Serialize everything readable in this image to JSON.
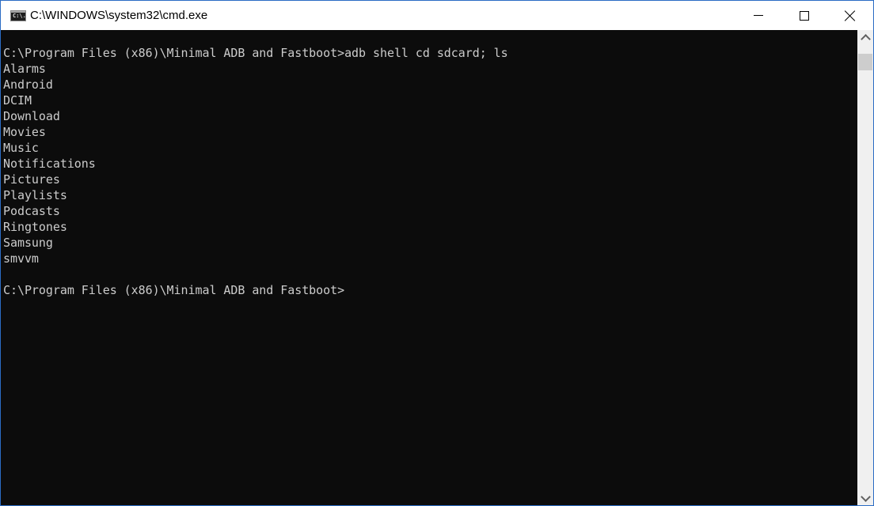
{
  "window": {
    "title": "C:\\WINDOWS\\system32\\cmd.exe",
    "icon": "cmd-icon",
    "icon_text": "C:\\."
  },
  "controls": {
    "minimize": "minimize-icon",
    "maximize": "maximize-icon",
    "close": "close-icon"
  },
  "console": {
    "lines": [
      "",
      "C:\\Program Files (x86)\\Minimal ADB and Fastboot>adb shell cd sdcard; ls",
      "Alarms",
      "Android",
      "DCIM",
      "Download",
      "Movies",
      "Music",
      "Notifications",
      "Pictures",
      "Playlists",
      "Podcasts",
      "Ringtones",
      "Samsung",
      "smvvm",
      "",
      "C:\\Program Files (x86)\\Minimal ADB and Fastboot>"
    ]
  },
  "colors": {
    "console_bg": "#0c0c0c",
    "console_fg": "#cccccc",
    "window_border": "#2b6cc4"
  }
}
